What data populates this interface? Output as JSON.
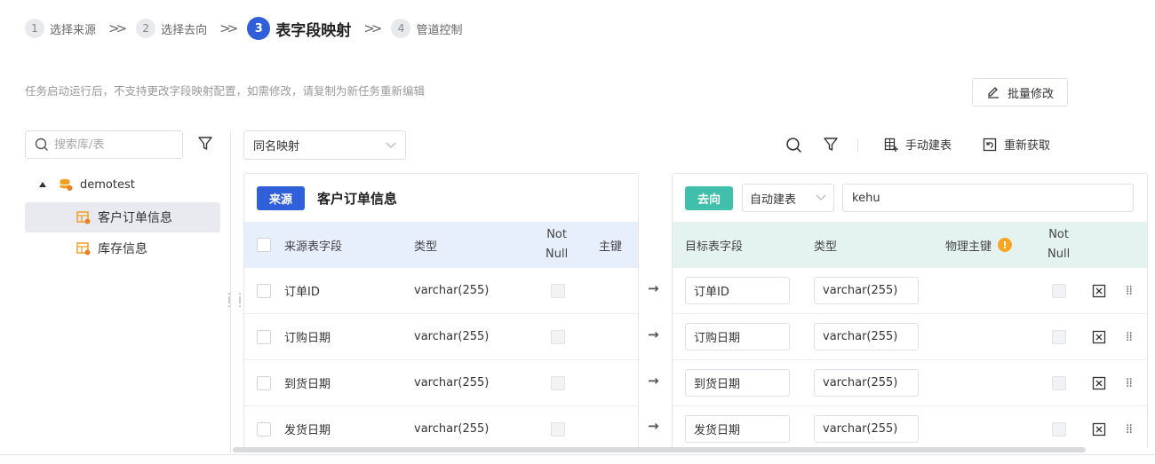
{
  "steps": [
    {
      "num": "1",
      "label": "选择来源"
    },
    {
      "num": "2",
      "label": "选择去向"
    },
    {
      "num": "3",
      "label": "表字段映射"
    },
    {
      "num": "4",
      "label": "管道控制"
    }
  ],
  "notice": "任务启动运行后，不支持更改字段映射配置，如需修改，请复制为新任务重新编辑",
  "batch_edit_label": "批量修改",
  "tree": {
    "search_placeholder": "搜索库/表",
    "root": "demotest",
    "items": [
      "客户订单信息",
      "库存信息"
    ]
  },
  "toolbar": {
    "mapping_mode": "同名映射",
    "manual_create": "手动建表",
    "refetch": "重新获取"
  },
  "source": {
    "tag": "来源",
    "table_name": "客户订单信息",
    "headers": {
      "field": "来源表字段",
      "type": "类型",
      "not_null_1": "Not",
      "not_null_2": "Null",
      "pk": "主键"
    },
    "rows": [
      {
        "field": "订单ID",
        "type": "varchar(255)"
      },
      {
        "field": "订购日期",
        "type": "varchar(255)"
      },
      {
        "field": "到货日期",
        "type": "varchar(255)"
      },
      {
        "field": "发货日期",
        "type": "varchar(255)"
      }
    ]
  },
  "target": {
    "tag": "去向",
    "mode": "自动建表",
    "table_value": "kehu",
    "headers": {
      "field": "目标表字段",
      "type": "类型",
      "pk": "物理主键",
      "not_null_1": "Not",
      "not_null_2": "Null"
    },
    "rows": [
      {
        "field": "订单ID",
        "type": "varchar(255)"
      },
      {
        "field": "订购日期",
        "type": "varchar(255)"
      },
      {
        "field": "到货日期",
        "type": "varchar(255)"
      },
      {
        "field": "发货日期",
        "type": "varchar(255)"
      }
    ]
  },
  "colors": {
    "primary": "#2f5fd9",
    "target_tag": "#3fbfac",
    "warning": "#f5a623"
  }
}
